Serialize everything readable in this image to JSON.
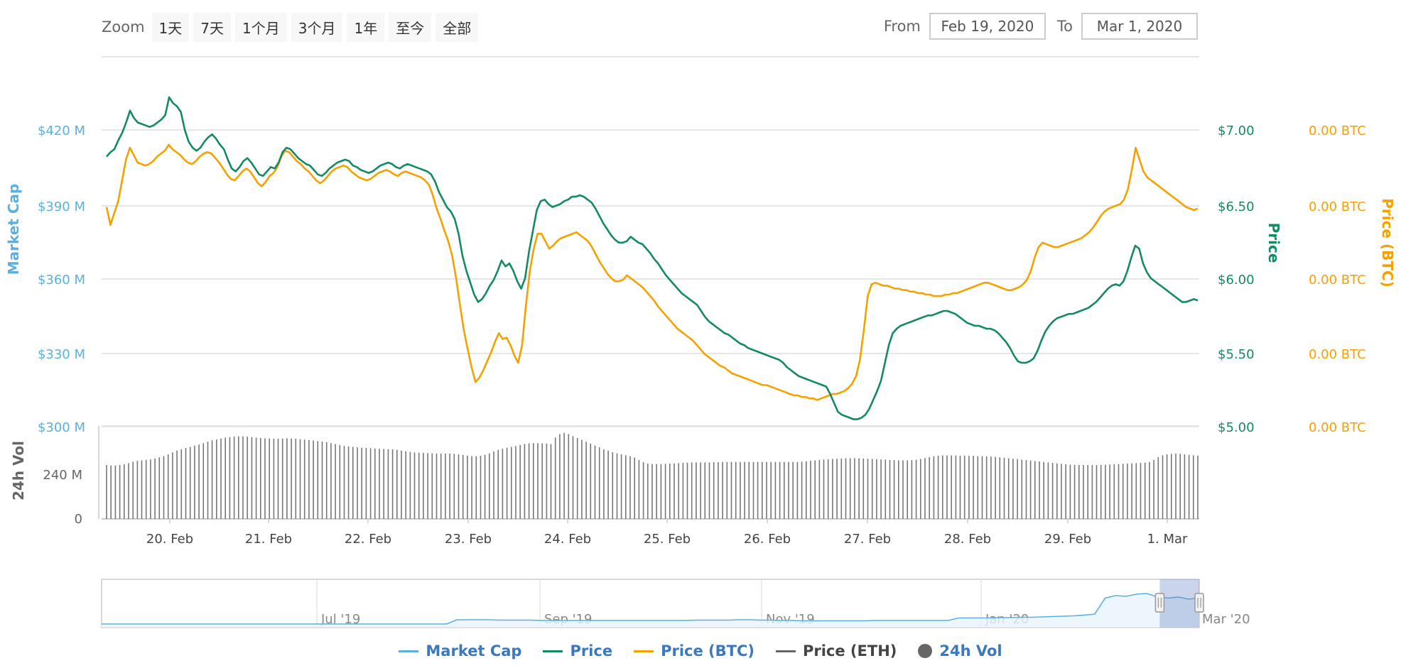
{
  "toolbar": {
    "zoom_label": "Zoom",
    "zoom_buttons": [
      "1天",
      "7天",
      "1个月",
      "3个月",
      "1年",
      "至今",
      "全部"
    ],
    "from_label": "From",
    "from_value": "Feb 19, 2020",
    "to_label": "To",
    "to_value": "Mar 1, 2020"
  },
  "colors": {
    "market_cap": "#5ab0e0",
    "price": "#138a63",
    "price_btc": "#f5a100",
    "price_eth": "#666666",
    "volume": "#777777"
  },
  "legend": [
    {
      "label": "Market Cap",
      "color": "#5ab0e0",
      "shape": "line"
    },
    {
      "label": "Price",
      "color": "#138a63",
      "shape": "line"
    },
    {
      "label": "Price (BTC)",
      "color": "#f5a100",
      "shape": "line"
    },
    {
      "label": "Price (ETH)",
      "color": "#666666",
      "shape": "line"
    },
    {
      "label": "24h Vol",
      "color": "#666666",
      "shape": "dot"
    }
  ],
  "chart_data": {
    "type": "line",
    "x_ticks": [
      "20. Feb",
      "21. Feb",
      "22. Feb",
      "23. Feb",
      "24. Feb",
      "25. Feb",
      "26. Feb",
      "27. Feb",
      "28. Feb",
      "29. Feb",
      "1. Mar"
    ],
    "y_left": {
      "label": "Market Cap",
      "ticks": [
        "$420 M",
        "$390 M",
        "$360 M",
        "$330 M",
        "$300 M"
      ],
      "range": [
        300,
        420
      ]
    },
    "y_right_price": {
      "label": "Price",
      "ticks": [
        "$7.00",
        "$6.50",
        "$6.00",
        "$5.50",
        "$5.00"
      ],
      "range": [
        5.0,
        7.0
      ]
    },
    "y_right_btc": {
      "label": "Price (BTC)",
      "ticks": [
        "0.00 BTC",
        "0.00 BTC",
        "0.00 BTC",
        "0.00 BTC",
        "0.00 BTC"
      ]
    },
    "volume_axis": {
      "label": "24h Vol",
      "ticks": [
        "240 M",
        "0"
      ],
      "range": [
        0,
        400
      ]
    },
    "series": [
      {
        "name": "Price",
        "time_start": "2020-02-19T09:00",
        "step_hours": 1,
        "values": [
          6.82,
          6.85,
          6.87,
          6.93,
          6.98,
          7.05,
          7.13,
          7.08,
          7.05,
          7.04,
          7.03,
          7.02,
          7.03,
          7.05,
          7.07,
          7.1,
          7.22,
          7.18,
          7.16,
          7.12,
          7.0,
          6.92,
          6.88,
          6.86,
          6.88,
          6.92,
          6.95,
          6.97,
          6.94,
          6.9,
          6.87,
          6.8,
          6.74,
          6.72,
          6.75,
          6.79,
          6.81,
          6.78,
          6.74,
          6.7,
          6.69,
          6.72,
          6.75,
          6.74,
          6.78,
          6.85,
          6.88,
          6.87,
          6.84,
          6.81,
          6.79,
          6.77,
          6.76,
          6.73,
          6.7,
          6.69,
          6.71,
          6.74,
          6.76,
          6.78,
          6.79,
          6.8,
          6.79,
          6.76,
          6.75,
          6.73,
          6.72,
          6.71,
          6.72,
          6.74,
          6.76,
          6.77,
          6.78,
          6.77,
          6.75,
          6.74,
          6.76,
          6.77,
          6.76,
          6.75,
          6.74,
          6.73,
          6.72,
          6.7,
          6.65,
          6.58,
          6.53,
          6.48,
          6.45,
          6.4,
          6.3,
          6.15,
          6.05,
          5.97,
          5.89,
          5.84,
          5.86,
          5.9,
          5.95,
          5.99,
          6.05,
          6.12,
          6.08,
          6.1,
          6.05,
          5.98,
          5.93,
          6.0,
          6.18,
          6.32,
          6.46,
          6.52,
          6.53,
          6.5,
          6.48,
          6.49,
          6.5,
          6.52,
          6.53,
          6.55,
          6.55,
          6.56,
          6.55,
          6.53,
          6.51,
          6.47,
          6.42,
          6.37,
          6.33,
          6.29,
          6.26,
          6.24,
          6.24,
          6.25,
          6.28,
          6.26,
          6.24,
          6.23,
          6.2,
          6.17,
          6.13,
          6.1,
          6.06,
          6.02,
          5.99,
          5.96,
          5.93,
          5.9,
          5.88,
          5.86,
          5.84,
          5.82,
          5.78,
          5.74,
          5.71,
          5.69,
          5.67,
          5.65,
          5.63,
          5.62,
          5.6,
          5.58,
          5.56,
          5.55,
          5.53,
          5.52,
          5.51,
          5.5,
          5.49,
          5.48,
          5.47,
          5.46,
          5.45,
          5.43,
          5.4,
          5.38,
          5.36,
          5.34,
          5.33,
          5.32,
          5.31,
          5.3,
          5.29,
          5.28,
          5.27,
          5.22,
          5.16,
          5.1,
          5.08,
          5.07,
          5.06,
          5.05,
          5.05,
          5.06,
          5.08,
          5.12,
          5.18,
          5.24,
          5.31,
          5.43,
          5.55,
          5.63,
          5.66,
          5.68,
          5.69,
          5.7,
          5.71,
          5.72,
          5.73,
          5.74,
          5.75,
          5.75,
          5.76,
          5.77,
          5.78,
          5.78,
          5.77,
          5.76,
          5.74,
          5.72,
          5.7,
          5.69,
          5.68,
          5.68,
          5.67,
          5.66,
          5.66,
          5.65,
          5.63,
          5.6,
          5.57,
          5.53,
          5.48,
          5.44,
          5.43,
          5.43,
          5.44,
          5.46,
          5.51,
          5.58,
          5.64,
          5.68,
          5.71,
          5.73,
          5.74,
          5.75,
          5.76,
          5.76,
          5.77,
          5.78,
          5.79,
          5.8,
          5.82,
          5.84,
          5.87,
          5.9,
          5.93,
          5.95,
          5.96,
          5.95,
          5.98,
          6.05,
          6.14,
          6.22,
          6.2,
          6.1,
          6.04,
          6.0,
          5.98,
          5.96,
          5.94,
          5.92,
          5.9,
          5.88,
          5.86,
          5.84,
          5.84,
          5.85,
          5.86,
          5.85
        ]
      },
      {
        "name": "Price (BTC)",
        "time_start": "2020-02-19T09:00",
        "step_hours": 1,
        "values": [
          6.48,
          6.36,
          6.44,
          6.52,
          6.66,
          6.8,
          6.88,
          6.83,
          6.78,
          6.77,
          6.76,
          6.77,
          6.79,
          6.82,
          6.84,
          6.86,
          6.9,
          6.87,
          6.85,
          6.83,
          6.8,
          6.78,
          6.77,
          6.79,
          6.82,
          6.84,
          6.85,
          6.84,
          6.81,
          6.78,
          6.74,
          6.7,
          6.67,
          6.66,
          6.69,
          6.72,
          6.74,
          6.72,
          6.68,
          6.64,
          6.62,
          6.65,
          6.69,
          6.71,
          6.75,
          6.82,
          6.86,
          6.85,
          6.82,
          6.79,
          6.77,
          6.74,
          6.72,
          6.69,
          6.66,
          6.64,
          6.66,
          6.69,
          6.72,
          6.74,
          6.75,
          6.76,
          6.75,
          6.72,
          6.7,
          6.68,
          6.67,
          6.66,
          6.67,
          6.69,
          6.71,
          6.72,
          6.73,
          6.72,
          6.7,
          6.69,
          6.71,
          6.72,
          6.71,
          6.7,
          6.69,
          6.68,
          6.66,
          6.63,
          6.56,
          6.47,
          6.4,
          6.32,
          6.25,
          6.15,
          6.0,
          5.82,
          5.65,
          5.52,
          5.4,
          5.3,
          5.33,
          5.38,
          5.44,
          5.5,
          5.57,
          5.63,
          5.59,
          5.6,
          5.55,
          5.48,
          5.43,
          5.55,
          5.82,
          6.05,
          6.2,
          6.3,
          6.3,
          6.25,
          6.2,
          6.22,
          6.25,
          6.27,
          6.28,
          6.29,
          6.3,
          6.31,
          6.29,
          6.27,
          6.25,
          6.21,
          6.16,
          6.11,
          6.07,
          6.03,
          6.0,
          5.98,
          5.98,
          5.99,
          6.02,
          6.0,
          5.98,
          5.96,
          5.94,
          5.91,
          5.88,
          5.85,
          5.81,
          5.78,
          5.75,
          5.72,
          5.69,
          5.66,
          5.64,
          5.62,
          5.6,
          5.58,
          5.55,
          5.52,
          5.49,
          5.47,
          5.45,
          5.43,
          5.41,
          5.4,
          5.38,
          5.36,
          5.35,
          5.34,
          5.33,
          5.32,
          5.31,
          5.3,
          5.29,
          5.28,
          5.28,
          5.27,
          5.26,
          5.25,
          5.24,
          5.23,
          5.22,
          5.21,
          5.21,
          5.2,
          5.2,
          5.19,
          5.19,
          5.18,
          5.19,
          5.2,
          5.21,
          5.22,
          5.22,
          5.23,
          5.24,
          5.26,
          5.29,
          5.34,
          5.45,
          5.65,
          5.88,
          5.96,
          5.97,
          5.96,
          5.95,
          5.95,
          5.94,
          5.93,
          5.93,
          5.92,
          5.92,
          5.91,
          5.91,
          5.9,
          5.9,
          5.89,
          5.89,
          5.88,
          5.88,
          5.88,
          5.89,
          5.89,
          5.9,
          5.9,
          5.91,
          5.92,
          5.93,
          5.94,
          5.95,
          5.96,
          5.97,
          5.97,
          5.96,
          5.95,
          5.94,
          5.93,
          5.92,
          5.92,
          5.93,
          5.94,
          5.96,
          5.99,
          6.05,
          6.14,
          6.21,
          6.24,
          6.23,
          6.22,
          6.21,
          6.21,
          6.22,
          6.23,
          6.24,
          6.25,
          6.26,
          6.27,
          6.29,
          6.31,
          6.34,
          6.38,
          6.42,
          6.45,
          6.47,
          6.48,
          6.49,
          6.5,
          6.53,
          6.6,
          6.73,
          6.88,
          6.8,
          6.72,
          6.68,
          6.66,
          6.64,
          6.62,
          6.6,
          6.58,
          6.56,
          6.54,
          6.52,
          6.5,
          6.48,
          6.47,
          6.46,
          6.47
        ]
      },
      {
        "name": "24h Vol",
        "values": [
          232,
          230,
          230,
          232,
          235,
          240,
          246,
          250,
          252,
          254,
          256,
          260,
          265,
          270,
          278,
          286,
          294,
          300,
          305,
          310,
          315,
          320,
          326,
          332,
          338,
          342,
          346,
          350,
          352,
          354,
          355,
          355,
          354,
          352,
          350,
          348,
          347,
          346,
          345,
          345,
          346,
          347,
          346,
          345,
          343,
          341,
          339,
          337,
          335,
          333,
          330,
          326,
          322,
          318,
          314,
          312,
          310,
          308,
          306,
          305,
          304,
          303,
          302,
          301,
          300,
          299,
          297,
          294,
          291,
          288,
          286,
          285,
          284,
          283,
          282,
          281,
          281,
          281,
          281,
          280,
          278,
          275,
          272,
          270,
          270,
          271,
          275,
          282,
          290,
          297,
          302,
          306,
          310,
          314,
          318,
          322,
          325,
          326,
          326,
          325,
          324,
          322,
          350,
          365,
          370,
          365,
          356,
          348,
          340,
          332,
          324,
          316,
          308,
          300,
          293,
          287,
          282,
          278,
          274,
          270,
          264,
          254,
          244,
          238,
          236,
          236,
          236,
          237,
          238,
          239,
          240,
          241,
          242,
          243,
          243,
          243,
          243,
          243,
          244,
          244,
          245,
          245,
          245,
          245,
          245,
          245,
          245,
          245,
          245,
          245,
          245,
          245,
          245,
          245,
          245,
          245,
          245,
          245,
          246,
          248,
          250,
          252,
          254,
          256,
          257,
          258,
          259,
          260,
          261,
          261,
          261,
          261,
          260,
          259,
          258,
          257,
          256,
          255,
          254,
          253,
          252,
          252,
          252,
          253,
          255,
          258,
          262,
          266,
          270,
          272,
          273,
          273,
          273,
          273,
          272,
          272,
          271,
          271,
          270,
          270,
          269,
          268,
          267,
          265,
          263,
          261,
          259,
          257,
          255,
          253,
          251,
          249,
          247,
          245,
          243,
          241,
          239,
          237,
          235,
          234,
          233,
          232,
          232,
          232,
          232,
          232,
          232,
          233,
          234,
          235,
          236,
          237,
          238,
          239,
          240,
          241,
          242,
          245,
          254,
          266,
          274,
          278,
          280,
          281,
          280,
          278,
          276,
          274,
          272
        ]
      }
    ],
    "navigator": {
      "ticks": [
        "Jul '19",
        "Sep '19",
        "Nov '19",
        "Jan '20",
        "Mar '20"
      ],
      "series": [
        0.02,
        0.02,
        0.02,
        0.02,
        0.02,
        0.02,
        0.02,
        0.02,
        0.02,
        0.02,
        0.02,
        0.02,
        0.02,
        0.02,
        0.02,
        0.02,
        0.02,
        0.02,
        0.02,
        0.02,
        0.02,
        0.02,
        0.02,
        0.02,
        0.02,
        0.02,
        0.02,
        0.02,
        0.02,
        0.02,
        0.02,
        0.02,
        0.02,
        0.02,
        0.14,
        0.14,
        0.14,
        0.14,
        0.13,
        0.13,
        0.13,
        0.13,
        0.12,
        0.12,
        0.12,
        0.12,
        0.12,
        0.12,
        0.12,
        0.12,
        0.12,
        0.12,
        0.12,
        0.12,
        0.12,
        0.12,
        0.12,
        0.13,
        0.13,
        0.13,
        0.13,
        0.14,
        0.14,
        0.13,
        0.13,
        0.12,
        0.12,
        0.11,
        0.11,
        0.11,
        0.11,
        0.11,
        0.11,
        0.11,
        0.12,
        0.12,
        0.12,
        0.12,
        0.12,
        0.12,
        0.12,
        0.12,
        0.19,
        0.19,
        0.19,
        0.19,
        0.2,
        0.2,
        0.21,
        0.21,
        0.22,
        0.23,
        0.24,
        0.25,
        0.27,
        0.3,
        0.75,
        0.82,
        0.8,
        0.86,
        0.88,
        0.78,
        0.75,
        0.78,
        0.72,
        0.76
      ],
      "selection_fraction": [
        0.964,
        1.0
      ]
    }
  }
}
